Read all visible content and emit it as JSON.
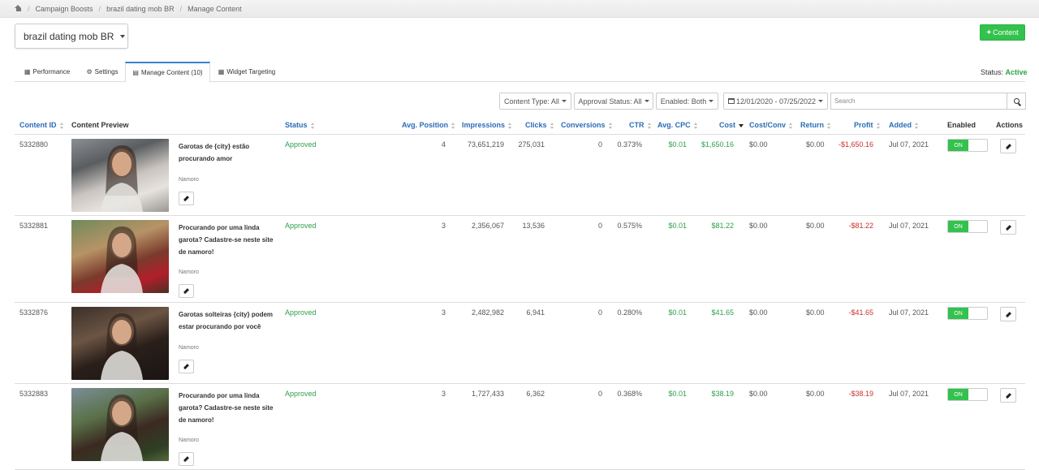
{
  "breadcrumb": {
    "items": [
      "Campaign Boosts",
      "brazil dating mob BR",
      "Manage Content"
    ]
  },
  "campaign_select": {
    "value": "brazil dating mob BR"
  },
  "add_content": {
    "label": "Content"
  },
  "tabs": [
    {
      "label": "Performance",
      "icon": "bar-chart-icon"
    },
    {
      "label": "Settings",
      "icon": "gear-icon"
    },
    {
      "label": "Manage Content (10)",
      "icon": "file-icon"
    },
    {
      "label": "Widget Targeting",
      "icon": "grid-icon"
    }
  ],
  "status": {
    "label": "Status:",
    "value": "Active",
    "color": "#2ea04a"
  },
  "filters": {
    "content_type": "Content Type: All",
    "approval_status": "Approval Status: All",
    "enabled": "Enabled: Both",
    "date_range": "12/01/2020 - 07/25/2022",
    "search_placeholder": "Search"
  },
  "table": {
    "headers": {
      "content_id": "Content ID",
      "content_preview": "Content Preview",
      "status": "Status",
      "avg_position": "Avg. Position",
      "impressions": "Impressions",
      "clicks": "Clicks",
      "conversions": "Conversions",
      "ctr": "CTR",
      "avg_cpc": "Avg. CPC",
      "cost": "Cost",
      "cost_conv": "Cost/Conv",
      "return": "Return",
      "profit": "Profit",
      "added": "Added",
      "enabled": "Enabled",
      "actions": "Actions"
    },
    "rows": [
      {
        "id": "5332880",
        "headline": "Garotas de {city} estão procurando amor",
        "category": "Namoro",
        "status": "Approved",
        "avg_position": "4",
        "impressions": "73,651,219",
        "clicks": "275,031",
        "conversions": "0",
        "ctr": "0.373%",
        "avg_cpc": "$0.01",
        "cost": "$1,650.16",
        "cost_conv": "$0.00",
        "return": "$0.00",
        "profit": "-$1,650.16",
        "added": "Jul 07, 2021",
        "enabled": "ON"
      },
      {
        "id": "5332881",
        "headline": "Procurando por uma linda garota? Cadastre-se neste site de namoro!",
        "category": "Namoro",
        "status": "Approved",
        "avg_position": "3",
        "impressions": "2,356,067",
        "clicks": "13,536",
        "conversions": "0",
        "ctr": "0.575%",
        "avg_cpc": "$0.01",
        "cost": "$81.22",
        "cost_conv": "$0.00",
        "return": "$0.00",
        "profit": "-$81.22",
        "added": "Jul 07, 2021",
        "enabled": "ON"
      },
      {
        "id": "5332876",
        "headline": "Garotas solteiras {city} podem estar procurando por você",
        "category": "Namoro",
        "status": "Approved",
        "avg_position": "3",
        "impressions": "2,482,982",
        "clicks": "6,941",
        "conversions": "0",
        "ctr": "0.280%",
        "avg_cpc": "$0.01",
        "cost": "$41.65",
        "cost_conv": "$0.00",
        "return": "$0.00",
        "profit": "-$41.65",
        "added": "Jul 07, 2021",
        "enabled": "ON"
      },
      {
        "id": "5332883",
        "headline": "Procurando por uma linda garota? Cadastre-se neste site de namoro!",
        "category": "Namoro",
        "status": "Approved",
        "avg_position": "3",
        "impressions": "1,727,433",
        "clicks": "6,362",
        "conversions": "0",
        "ctr": "0.368%",
        "avg_cpc": "$0.01",
        "cost": "$38.19",
        "cost_conv": "$0.00",
        "return": "$0.00",
        "profit": "-$38.19",
        "added": "Jul 07, 2021",
        "enabled": "ON"
      }
    ]
  }
}
